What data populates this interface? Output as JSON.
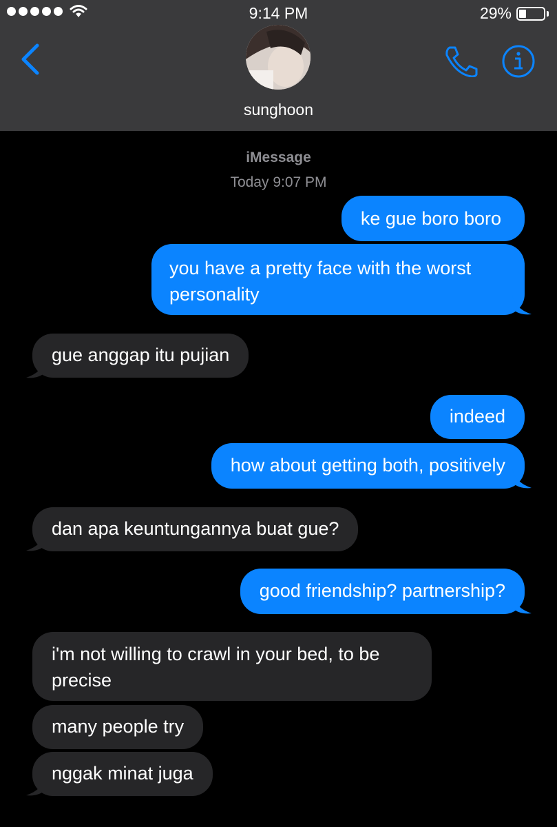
{
  "status_bar": {
    "time": "9:14 PM",
    "battery": "29%",
    "battery_level": 0.29
  },
  "header": {
    "contact_name": "sunghoon"
  },
  "thread": {
    "service": "iMessage",
    "timestamp_day": "Today",
    "timestamp_time": "9:07 PM"
  },
  "messages": [
    {
      "from": "me",
      "lines": [
        "ke gue boro boro"
      ]
    },
    {
      "from": "me",
      "lines": [
        "you have a pretty face with the worst",
        "personality"
      ]
    },
    {
      "from": "them",
      "lines": [
        "gue anggap itu pujian"
      ]
    },
    {
      "from": "me",
      "lines": [
        "indeed"
      ]
    },
    {
      "from": "me",
      "lines": [
        "how about getting both, positively"
      ]
    },
    {
      "from": "them",
      "lines": [
        "dan apa keuntungannya buat gue?"
      ]
    },
    {
      "from": "me",
      "lines": [
        "good friendship? partnership?"
      ]
    },
    {
      "from": "them",
      "lines": [
        "i'm not willing to crawl in your bed, to be",
        "precise"
      ]
    },
    {
      "from": "them",
      "lines": [
        "many people try"
      ]
    },
    {
      "from": "them",
      "lines": [
        "nggak minat juga"
      ]
    }
  ],
  "colors": {
    "sent_bubble": "#0b84ff",
    "received_bubble": "#262628",
    "header_bg": "#3a3a3c",
    "accent": "#0b84ff"
  },
  "icons": [
    "back-chevron-icon",
    "phone-icon",
    "info-icon",
    "wifi-icon",
    "battery-icon"
  ]
}
